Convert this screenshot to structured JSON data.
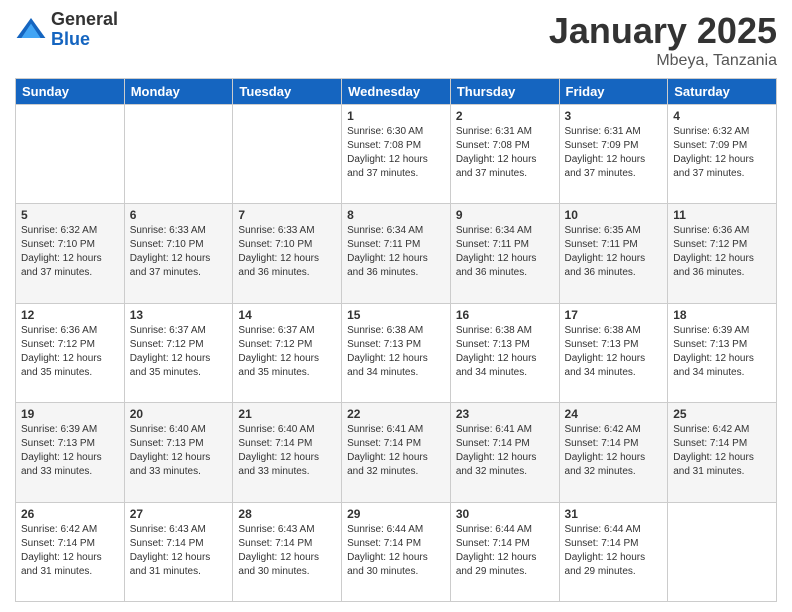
{
  "logo": {
    "general": "General",
    "blue": "Blue"
  },
  "title": "January 2025",
  "location": "Mbeya, Tanzania",
  "days_of_week": [
    "Sunday",
    "Monday",
    "Tuesday",
    "Wednesday",
    "Thursday",
    "Friday",
    "Saturday"
  ],
  "weeks": [
    [
      {
        "day": "",
        "info": ""
      },
      {
        "day": "",
        "info": ""
      },
      {
        "day": "",
        "info": ""
      },
      {
        "day": "1",
        "info": "Sunrise: 6:30 AM\nSunset: 7:08 PM\nDaylight: 12 hours and 37 minutes."
      },
      {
        "day": "2",
        "info": "Sunrise: 6:31 AM\nSunset: 7:08 PM\nDaylight: 12 hours and 37 minutes."
      },
      {
        "day": "3",
        "info": "Sunrise: 6:31 AM\nSunset: 7:09 PM\nDaylight: 12 hours and 37 minutes."
      },
      {
        "day": "4",
        "info": "Sunrise: 6:32 AM\nSunset: 7:09 PM\nDaylight: 12 hours and 37 minutes."
      }
    ],
    [
      {
        "day": "5",
        "info": "Sunrise: 6:32 AM\nSunset: 7:10 PM\nDaylight: 12 hours and 37 minutes."
      },
      {
        "day": "6",
        "info": "Sunrise: 6:33 AM\nSunset: 7:10 PM\nDaylight: 12 hours and 37 minutes."
      },
      {
        "day": "7",
        "info": "Sunrise: 6:33 AM\nSunset: 7:10 PM\nDaylight: 12 hours and 36 minutes."
      },
      {
        "day": "8",
        "info": "Sunrise: 6:34 AM\nSunset: 7:11 PM\nDaylight: 12 hours and 36 minutes."
      },
      {
        "day": "9",
        "info": "Sunrise: 6:34 AM\nSunset: 7:11 PM\nDaylight: 12 hours and 36 minutes."
      },
      {
        "day": "10",
        "info": "Sunrise: 6:35 AM\nSunset: 7:11 PM\nDaylight: 12 hours and 36 minutes."
      },
      {
        "day": "11",
        "info": "Sunrise: 6:36 AM\nSunset: 7:12 PM\nDaylight: 12 hours and 36 minutes."
      }
    ],
    [
      {
        "day": "12",
        "info": "Sunrise: 6:36 AM\nSunset: 7:12 PM\nDaylight: 12 hours and 35 minutes."
      },
      {
        "day": "13",
        "info": "Sunrise: 6:37 AM\nSunset: 7:12 PM\nDaylight: 12 hours and 35 minutes."
      },
      {
        "day": "14",
        "info": "Sunrise: 6:37 AM\nSunset: 7:12 PM\nDaylight: 12 hours and 35 minutes."
      },
      {
        "day": "15",
        "info": "Sunrise: 6:38 AM\nSunset: 7:13 PM\nDaylight: 12 hours and 34 minutes."
      },
      {
        "day": "16",
        "info": "Sunrise: 6:38 AM\nSunset: 7:13 PM\nDaylight: 12 hours and 34 minutes."
      },
      {
        "day": "17",
        "info": "Sunrise: 6:38 AM\nSunset: 7:13 PM\nDaylight: 12 hours and 34 minutes."
      },
      {
        "day": "18",
        "info": "Sunrise: 6:39 AM\nSunset: 7:13 PM\nDaylight: 12 hours and 34 minutes."
      }
    ],
    [
      {
        "day": "19",
        "info": "Sunrise: 6:39 AM\nSunset: 7:13 PM\nDaylight: 12 hours and 33 minutes."
      },
      {
        "day": "20",
        "info": "Sunrise: 6:40 AM\nSunset: 7:13 PM\nDaylight: 12 hours and 33 minutes."
      },
      {
        "day": "21",
        "info": "Sunrise: 6:40 AM\nSunset: 7:14 PM\nDaylight: 12 hours and 33 minutes."
      },
      {
        "day": "22",
        "info": "Sunrise: 6:41 AM\nSunset: 7:14 PM\nDaylight: 12 hours and 32 minutes."
      },
      {
        "day": "23",
        "info": "Sunrise: 6:41 AM\nSunset: 7:14 PM\nDaylight: 12 hours and 32 minutes."
      },
      {
        "day": "24",
        "info": "Sunrise: 6:42 AM\nSunset: 7:14 PM\nDaylight: 12 hours and 32 minutes."
      },
      {
        "day": "25",
        "info": "Sunrise: 6:42 AM\nSunset: 7:14 PM\nDaylight: 12 hours and 31 minutes."
      }
    ],
    [
      {
        "day": "26",
        "info": "Sunrise: 6:42 AM\nSunset: 7:14 PM\nDaylight: 12 hours and 31 minutes."
      },
      {
        "day": "27",
        "info": "Sunrise: 6:43 AM\nSunset: 7:14 PM\nDaylight: 12 hours and 31 minutes."
      },
      {
        "day": "28",
        "info": "Sunrise: 6:43 AM\nSunset: 7:14 PM\nDaylight: 12 hours and 30 minutes."
      },
      {
        "day": "29",
        "info": "Sunrise: 6:44 AM\nSunset: 7:14 PM\nDaylight: 12 hours and 30 minutes."
      },
      {
        "day": "30",
        "info": "Sunrise: 6:44 AM\nSunset: 7:14 PM\nDaylight: 12 hours and 29 minutes."
      },
      {
        "day": "31",
        "info": "Sunrise: 6:44 AM\nSunset: 7:14 PM\nDaylight: 12 hours and 29 minutes."
      },
      {
        "day": "",
        "info": ""
      }
    ]
  ]
}
